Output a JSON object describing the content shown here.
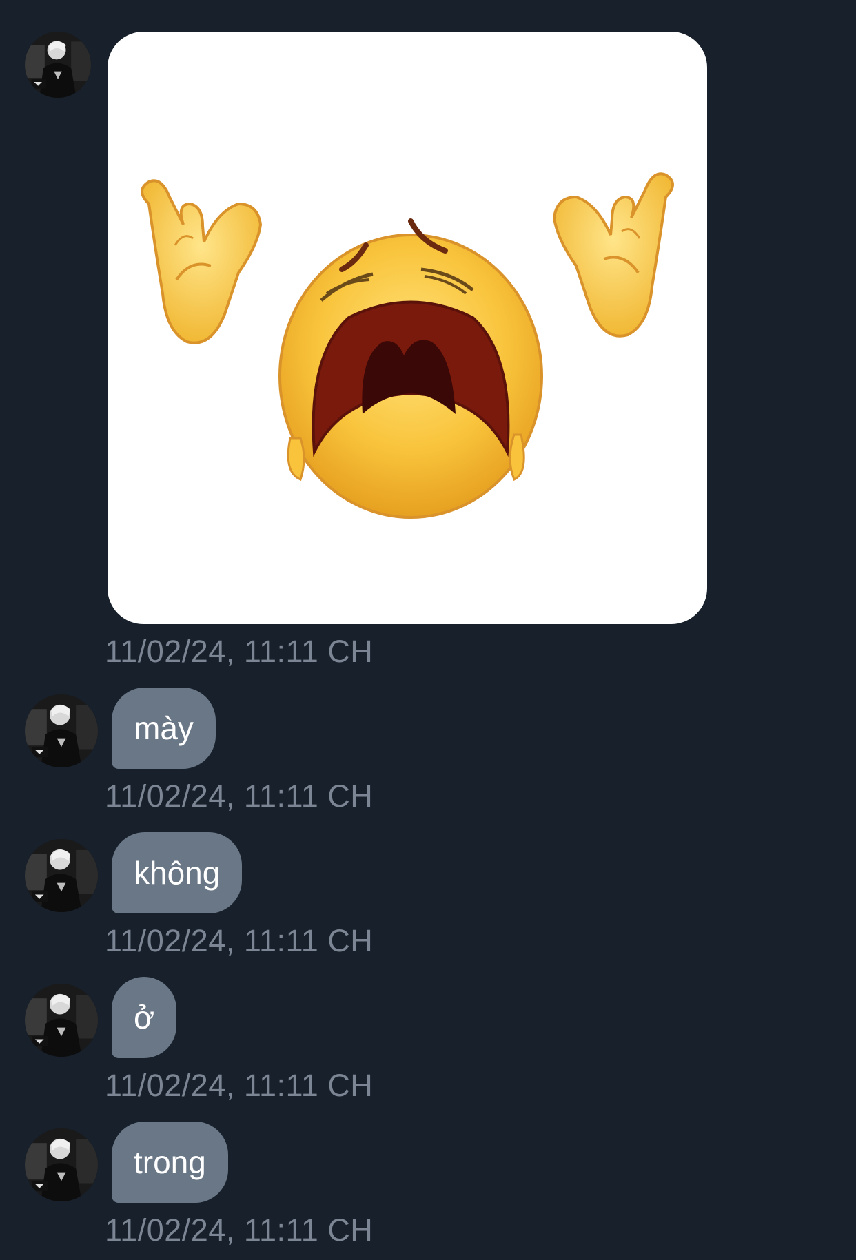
{
  "conversation": {
    "messages": [
      {
        "type": "sticker",
        "sticker_icon": "crying-emoji-sticker",
        "timestamp": "11/02/24, 11:11 CH"
      },
      {
        "type": "text",
        "text": "mày",
        "timestamp": "11/02/24, 11:11 CH"
      },
      {
        "type": "text",
        "text": "không",
        "timestamp": "11/02/24, 11:11 CH"
      },
      {
        "type": "text",
        "text": "ở",
        "timestamp": "11/02/24, 11:11 CH"
      },
      {
        "type": "text",
        "text": "trong",
        "timestamp": "11/02/24, 11:11 CH"
      }
    ]
  },
  "colors": {
    "background": "#17202b",
    "bubble": "#6a7787",
    "timestamp": "#7c8593",
    "bubble_text": "#ffffff"
  }
}
